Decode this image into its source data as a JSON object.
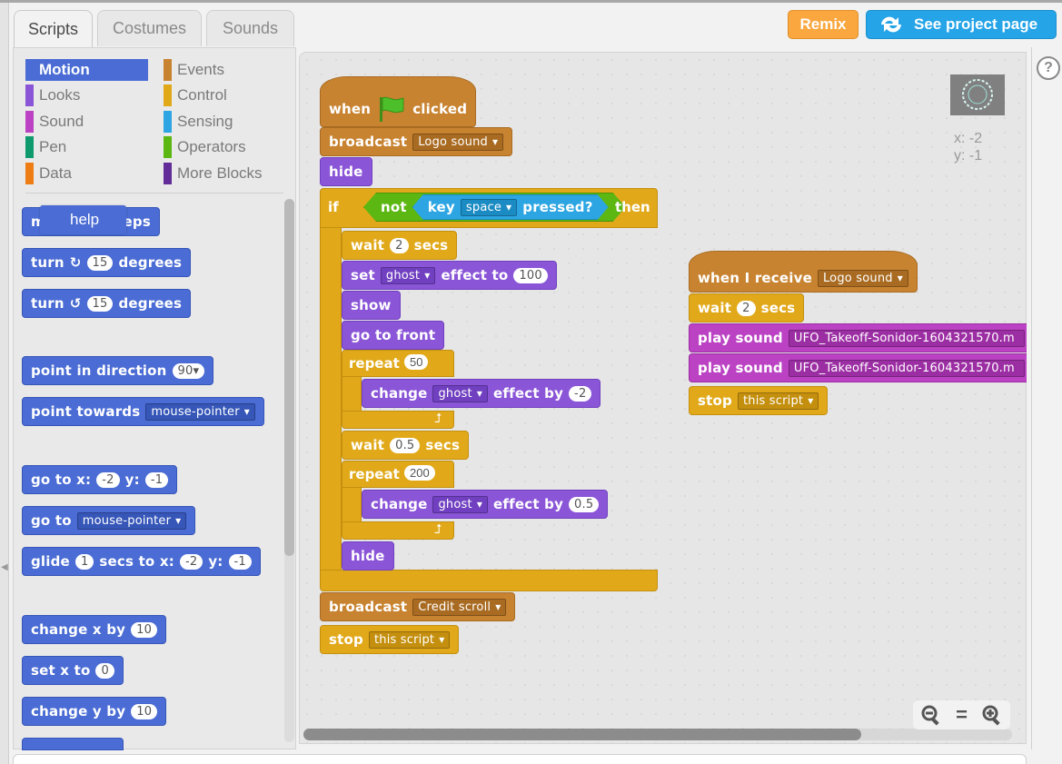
{
  "tabs": [
    "Scripts",
    "Costumes",
    "Sounds"
  ],
  "header": {
    "remix_label": "Remix",
    "see_project_label": "See project page"
  },
  "categories": {
    "left": [
      {
        "label": "Motion",
        "color": "#4a6cd4"
      },
      {
        "label": "Looks",
        "color": "#8a55d7"
      },
      {
        "label": "Sound",
        "color": "#bb42c3"
      },
      {
        "label": "Pen",
        "color": "#0e9a6c"
      },
      {
        "label": "Data",
        "color": "#ee7d16"
      }
    ],
    "right": [
      {
        "label": "Events",
        "color": "#c88330"
      },
      {
        "label": "Control",
        "color": "#e1a91a"
      },
      {
        "label": "Sensing",
        "color": "#2ca5e2"
      },
      {
        "label": "Operators",
        "color": "#5cb712"
      },
      {
        "label": "More Blocks",
        "color": "#632d99"
      }
    ]
  },
  "palette": {
    "tooltip": "help",
    "move_frag1": "m",
    "move_frag2": "teps",
    "turn": "turn",
    "degrees": "degrees",
    "turn_val": "15",
    "point_in_direction": "point in direction",
    "direction_val": "90",
    "point_towards": "point towards",
    "mouse_pointer": "mouse-pointer",
    "go_to_x": "go to x:",
    "y": "y:",
    "x_val": "-2",
    "y_val": "-1",
    "go_to": "go to",
    "glide": "glide",
    "glide_secs": "1",
    "secs_to_x": "secs to x:",
    "change_x_by": "change x by",
    "change_x_val": "10",
    "set_x_to": "set x to",
    "set_x_val": "0",
    "change_y_by": "change y by",
    "change_y_val": "10"
  },
  "script1": {
    "when": "when",
    "clicked": "clicked",
    "broadcast": "broadcast",
    "logo_sound": "Logo sound",
    "hide": "hide",
    "if": "if",
    "not": "not",
    "key": "key",
    "space": "space",
    "pressed": "pressed?",
    "then": "then",
    "wait": "wait",
    "wait1_val": "2",
    "secs": "secs",
    "set": "set",
    "ghost": "ghost",
    "effect_to": "effect to",
    "effect_val": "100",
    "show": "show",
    "go_to_front": "go to front",
    "repeat": "repeat",
    "repeat1_val": "50",
    "change": "change",
    "effect_by": "effect by",
    "change1_val": "-2",
    "wait2_val": "0.5",
    "repeat2_val": "200",
    "change2_val": "0.5",
    "hide2": "hide",
    "credit_scroll": "Credit scroll",
    "stop": "stop",
    "this_script": "this script"
  },
  "script2": {
    "when_i_receive": "when I receive",
    "logo_sound": "Logo sound",
    "wait": "wait",
    "wait_val": "2",
    "secs": "secs",
    "play_sound": "play sound",
    "sound_name": "UFO_Takeoff-Sonidor-1604321570.m",
    "stop": "stop",
    "this_script": "this script"
  },
  "stage": {
    "x_readout": "x: -2",
    "y_readout": "y: -1"
  },
  "zoom": {
    "out": "zoom-out",
    "reset": "=",
    "in": "zoom-in"
  },
  "help": "?"
}
